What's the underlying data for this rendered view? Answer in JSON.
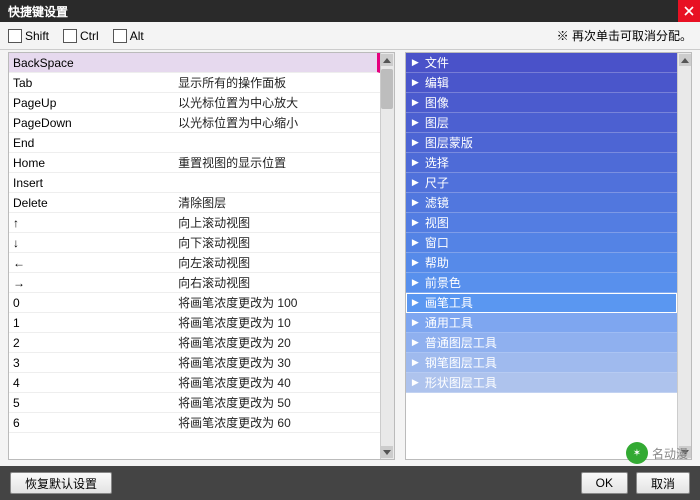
{
  "window": {
    "title": "快捷键设置"
  },
  "mods": {
    "shift": "Shift",
    "ctrl": "Ctrl",
    "alt": "Alt"
  },
  "hint": "※ 再次单击可取消分配。",
  "selected_key_index": 0,
  "keys": [
    {
      "key": "BackSpace",
      "action": ""
    },
    {
      "key": "Tab",
      "action": "显示所有的操作面板"
    },
    {
      "key": "PageUp",
      "action": "以光标位置为中心放大"
    },
    {
      "key": "PageDown",
      "action": "以光标位置为中心缩小"
    },
    {
      "key": "End",
      "action": ""
    },
    {
      "key": "Home",
      "action": "重置视图的显示位置"
    },
    {
      "key": "Insert",
      "action": ""
    },
    {
      "key": "Delete",
      "action": "清除图层"
    },
    {
      "key": "↑",
      "action": "向上滚动视图"
    },
    {
      "key": "↓",
      "action": "向下滚动视图"
    },
    {
      "key": "←",
      "action": "向左滚动视图"
    },
    {
      "key": "→",
      "action": "向右滚动视图"
    },
    {
      "key": "0",
      "action": "将画笔浓度更改为 100"
    },
    {
      "key": "1",
      "action": "将画笔浓度更改为 10"
    },
    {
      "key": "2",
      "action": "将画笔浓度更改为 20"
    },
    {
      "key": "3",
      "action": "将画笔浓度更改为 30"
    },
    {
      "key": "4",
      "action": "将画笔浓度更改为 40"
    },
    {
      "key": "5",
      "action": "将画笔浓度更改为 50"
    },
    {
      "key": "6",
      "action": "将画笔浓度更改为 60"
    }
  ],
  "selected_category_index": 12,
  "categories": [
    "文件",
    "编辑",
    "图像",
    "图层",
    "图层蒙版",
    "选择",
    "尺子",
    "滤镜",
    "视图",
    "窗口",
    "帮助",
    "前景色",
    "画笔工具",
    "通用工具",
    "普通图层工具",
    "钢笔图层工具",
    "形状图层工具"
  ],
  "footer": {
    "restore": "恢复默认设置",
    "ok": "OK",
    "cancel": "取消"
  },
  "watermark": "名动漫"
}
